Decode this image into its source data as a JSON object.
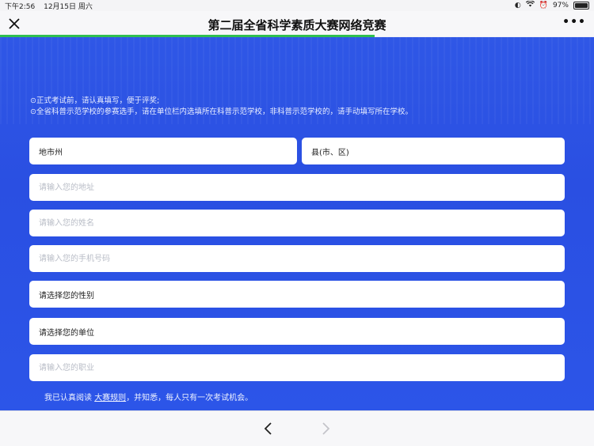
{
  "status": {
    "time": "下午2:56",
    "date": "12月15日 周六",
    "battery": "97%",
    "battery_level": 0.97
  },
  "header": {
    "title": "第二届全省科学素质大赛网络竞赛",
    "more_label": "•••",
    "progress": 0.63
  },
  "notes": [
    "⊙正式考试前，请认真填写，便于评奖;",
    "⊙全省科普示范学校的参赛选手，请在单位栏内选填所在科普示范学校，非科普示范学校的，请手动填写所在学校。"
  ],
  "form": {
    "city_select": "地市州",
    "county_select": "县(市、区)",
    "address_placeholder": "请输入您的地址",
    "name_placeholder": "请输入您的姓名",
    "phone_placeholder": "请输入您的手机号码",
    "gender_select": "请选择您的性别",
    "unit_select": "请选择您的单位",
    "job_placeholder": "请输入您的职业"
  },
  "agreement": {
    "prefix": "我已认真阅读",
    "link": "大赛规则",
    "suffix": "，并知悉，每人只有一次考试机会。"
  },
  "colors": {
    "background_blue": "#2c55e8",
    "progress_green": "#2fbf4f"
  }
}
